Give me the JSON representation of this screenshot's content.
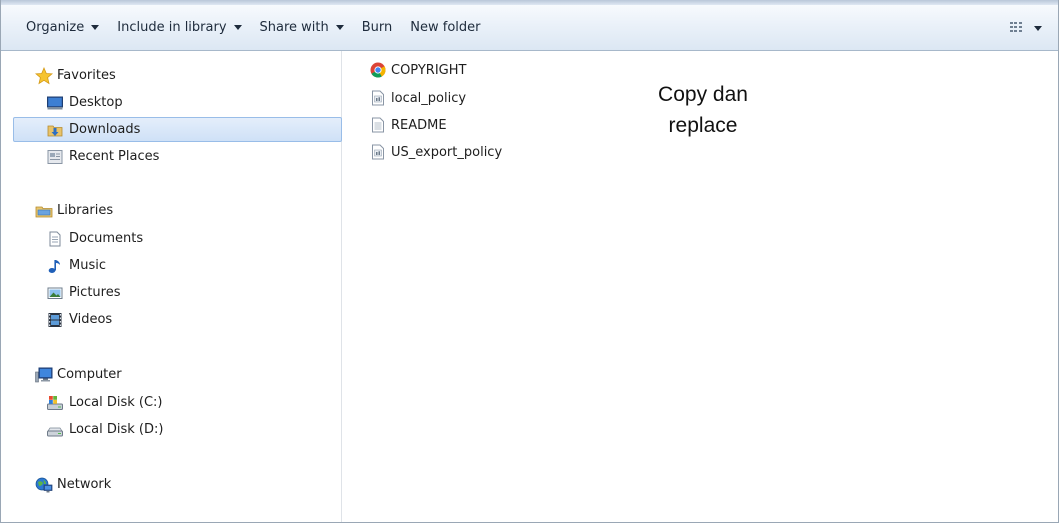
{
  "toolbar": {
    "organize": "Organize",
    "include_in_library": "Include in library",
    "share_with": "Share with",
    "burn": "Burn",
    "new_folder": "New folder",
    "view_icon": "view-options-icon"
  },
  "nav": {
    "favorites": {
      "label": "Favorites",
      "items": [
        {
          "label": "Desktop",
          "icon": "desktop-icon"
        },
        {
          "label": "Downloads",
          "icon": "downloads-folder-icon",
          "selected": true
        },
        {
          "label": "Recent Places",
          "icon": "recent-places-icon"
        }
      ]
    },
    "libraries": {
      "label": "Libraries",
      "items": [
        {
          "label": "Documents",
          "icon": "documents-icon"
        },
        {
          "label": "Music",
          "icon": "music-icon"
        },
        {
          "label": "Pictures",
          "icon": "pictures-icon"
        },
        {
          "label": "Videos",
          "icon": "videos-icon"
        }
      ]
    },
    "computer": {
      "label": "Computer",
      "items": [
        {
          "label": "Local Disk (C:)",
          "icon": "system-disk-icon"
        },
        {
          "label": "Local Disk (D:)",
          "icon": "disk-icon"
        }
      ]
    },
    "network": {
      "label": "Network"
    }
  },
  "files": [
    {
      "name": "COPYRIGHT",
      "icon": "chrome-html-icon"
    },
    {
      "name": "local_policy",
      "icon": "jar-file-icon"
    },
    {
      "name": "README",
      "icon": "text-file-icon"
    },
    {
      "name": "US_export_policy",
      "icon": "jar-file-icon"
    }
  ],
  "annotation": {
    "line1": "Copy dan",
    "line2": "replace"
  },
  "colors": {
    "selection_bg": "#cfe1f7",
    "selection_border": "#99bde8",
    "toolbar_bg": "#dce7f3"
  }
}
